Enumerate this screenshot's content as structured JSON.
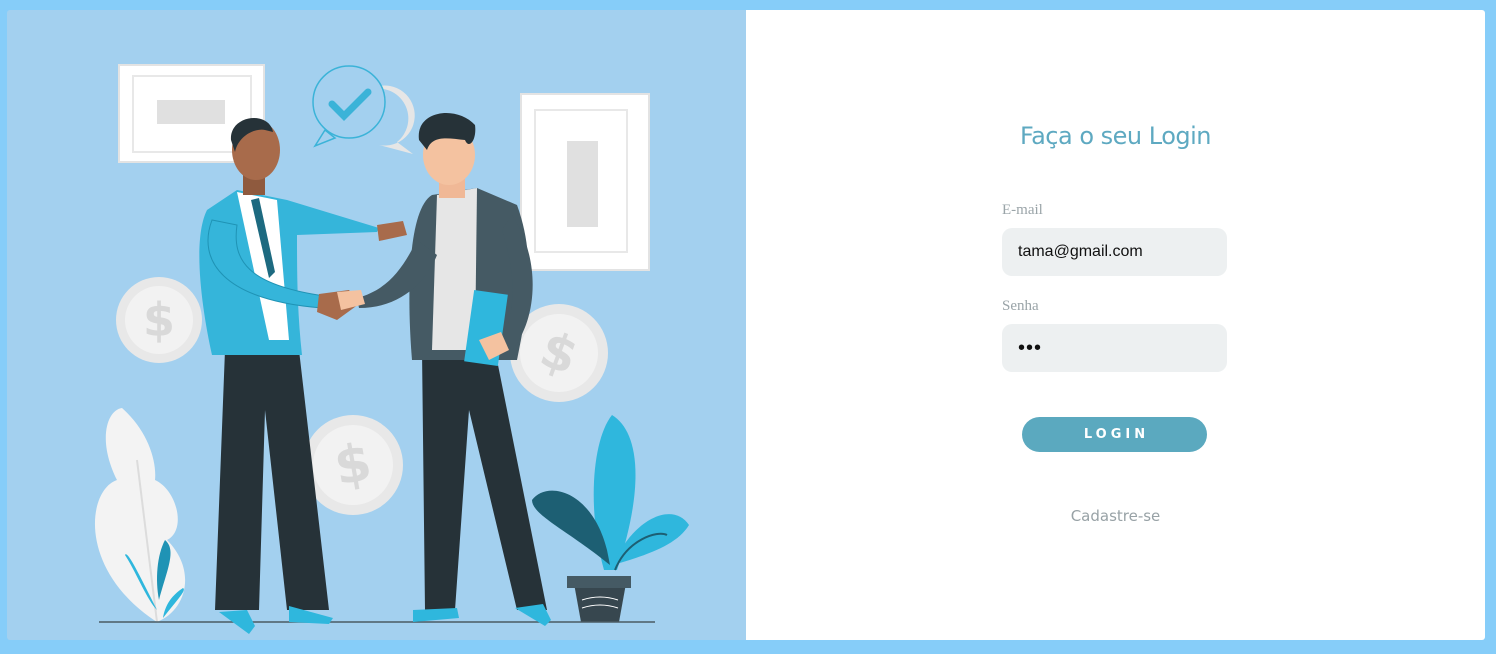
{
  "login": {
    "title": "Faça o seu Login",
    "email_label": "E-mail",
    "email_value": "tama@gmail.com",
    "password_label": "Senha",
    "password_value": "***",
    "button_label": "LOGIN",
    "register_link": "Cadastre-se"
  },
  "illustration": {
    "description_icon": "handshake-illustration",
    "coin_symbol": "$"
  },
  "colors": {
    "page_background": "#86cdf9",
    "illustration_background": "#a3d0ef",
    "accent": "#5ba9bf",
    "title": "#5ea9c1",
    "input_background": "#edf0f1"
  }
}
